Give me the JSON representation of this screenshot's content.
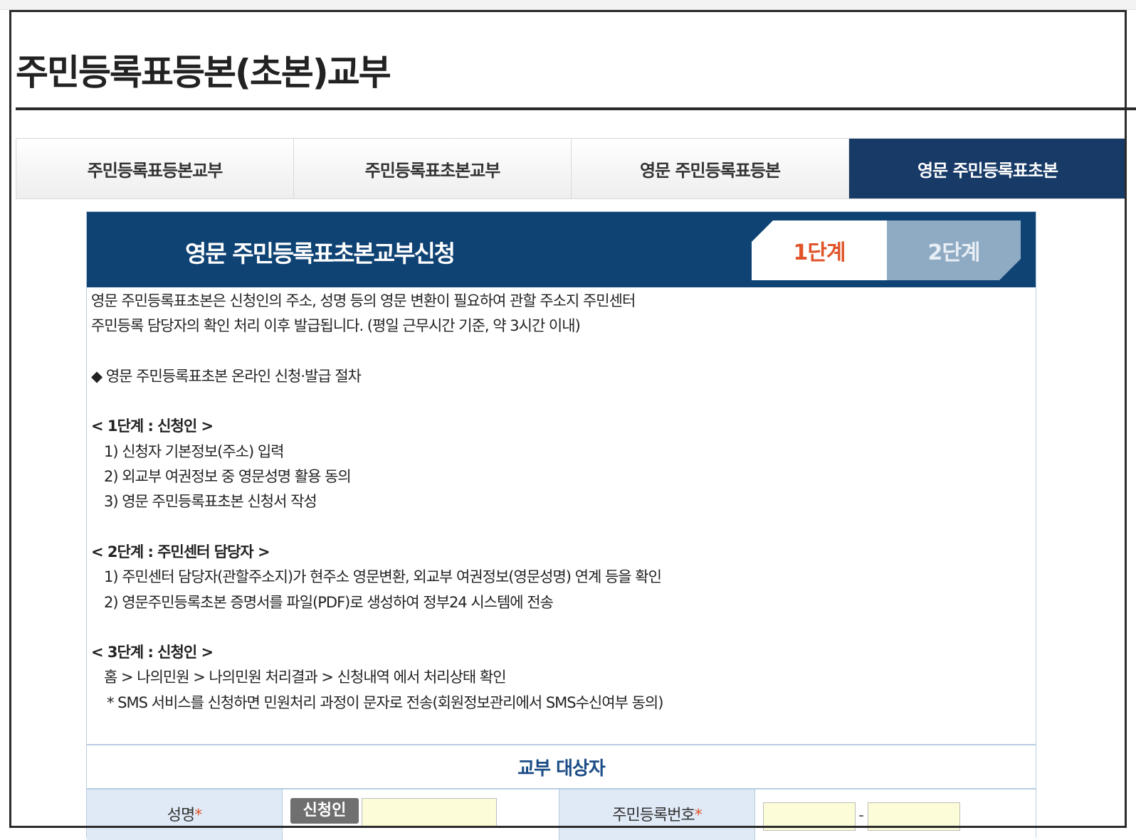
{
  "page_title": "주민등록표등본(초본)교부",
  "tabs": [
    {
      "label": "주민등록표등본교부",
      "active": false
    },
    {
      "label": "주민등록표초본교부",
      "active": false
    },
    {
      "label": "영문 주민등록표등본",
      "active": false
    },
    {
      "label": "영문 주민등록표초본",
      "active": true
    }
  ],
  "panel": {
    "title": "영문 주민등록표초본교부신청",
    "step1_label": "1단계",
    "step2_label": "2단계",
    "current_step": 1
  },
  "info": {
    "intro_line1": "영문 주민등록표초본은 신청인의 주소, 성명 등의 영문 변환이 필요하여 관할 주소지 주민센터",
    "intro_line2": "주민등록 담당자의 확인 처리 이후 발급됩니다. (평일 근무시간 기준, 약 3시간 이내)",
    "procedure_title": "◆ 영문 주민등록표초본 온라인 신청·발급 절차",
    "step1_heading": "< 1단계 : 신청인 >",
    "step1_items": [
      "1) 신청자 기본정보(주소) 입력",
      "2) 외교부 여권정보 중 영문성명 활용 동의",
      "3) 영문 주민등록표초본 신청서 작성"
    ],
    "step2_heading": "< 2단계 : 주민센터 담당자 >",
    "step2_items": [
      "1) 주민센터 담당자(관할주소지)가 현주소 영문변환, 외교부 여권정보(영문성명) 연계 등을 확인",
      "2) 영문주민등록초본 증명서를 파일(PDF)로 생성하여 정부24 시스템에 전송"
    ],
    "step3_heading": "< 3단계 : 신청인 >",
    "step3_items": [
      "홈 > 나의민원 > 나의민원 처리결과 > 신청내역 에서 처리상태 확인",
      "* SMS 서비스를 신청하면 민원처리 과정이 문자로 전송(회원정보관리에서 SMS수신여부 동의)"
    ]
  },
  "form": {
    "section_title": "교부 대상자",
    "name_label": "성명",
    "required_mark": "*",
    "applicant_button": "신청인",
    "name_value": "",
    "rrn_label": "주민등록번호",
    "rrn_dash": "-",
    "rrn_front_value": "",
    "rrn_back_value": ""
  },
  "colors": {
    "active_tab": "#173a66",
    "panel_header": "#0f4374",
    "step1_text": "#e1542a",
    "step2_bg": "#8fabc4",
    "section_title": "#1a4c85",
    "input_bg": "#fcfcd8"
  }
}
